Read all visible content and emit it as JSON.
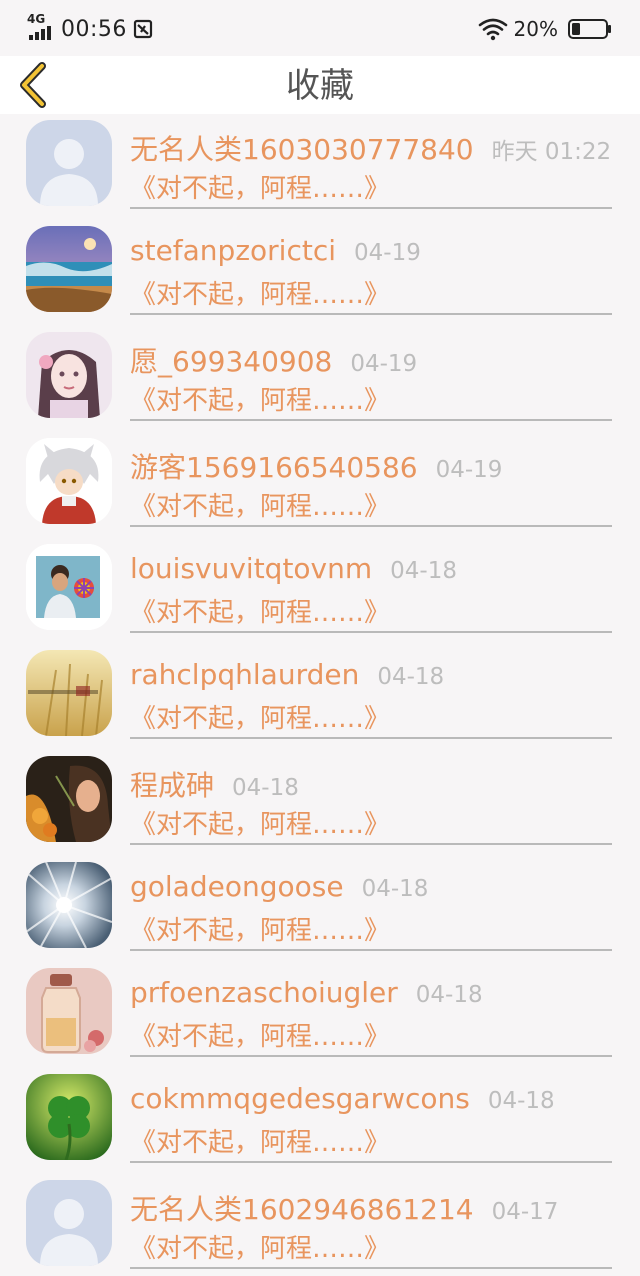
{
  "status_bar": {
    "network": "4G",
    "time": "00:56",
    "battery": "20%"
  },
  "header": {
    "title": "收藏"
  },
  "favorites": [
    {
      "user": "无名人类1603030777840",
      "date": "昨天 01:22",
      "title": "《对不起，阿程……》",
      "avatar": "default-avatar"
    },
    {
      "user": "stefanpzorictci",
      "date": "04-19",
      "title": "《对不起，阿程……》",
      "avatar": "seascape-avatar"
    },
    {
      "user": "愿_699340908",
      "date": "04-19",
      "title": "《对不起，阿程……》",
      "avatar": "anime-girl-avatar"
    },
    {
      "user": "游客1569166540586",
      "date": "04-19",
      "title": "《对不起，阿程……》",
      "avatar": "inuyasha-avatar"
    },
    {
      "user": "louisvuvitqtovnm",
      "date": "04-18",
      "title": "《对不起，阿程……》",
      "avatar": "man-photo-avatar"
    },
    {
      "user": "rahclpqhlaurden",
      "date": "04-18",
      "title": "《对不起，阿程……》",
      "avatar": "wheat-field-avatar"
    },
    {
      "user": "程成砷",
      "date": "04-18",
      "title": "《对不起，阿程……》",
      "avatar": "woman-portrait-avatar"
    },
    {
      "user": "goladeongoose",
      "date": "04-18",
      "title": "《对不起，阿程……》",
      "avatar": "sunburst-avatar"
    },
    {
      "user": "prfoenzaschoiugler",
      "date": "04-18",
      "title": "《对不起，阿程……》",
      "avatar": "glass-bottle-avatar"
    },
    {
      "user": "cokmmqgedesgarwcons",
      "date": "04-18",
      "title": "《对不起，阿程……》",
      "avatar": "clover-avatar"
    },
    {
      "user": "无名人类1602946861214",
      "date": "04-17",
      "title": "《对不起，阿程……》",
      "avatar": "default-avatar"
    }
  ]
}
